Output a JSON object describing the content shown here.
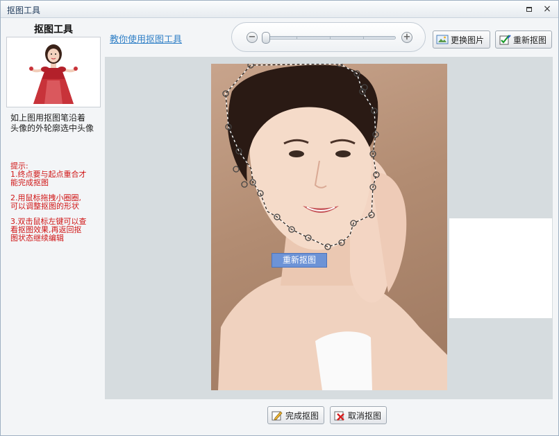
{
  "window": {
    "title": "抠图工具"
  },
  "left": {
    "title": "抠图工具",
    "instruction_line1": "如上图用抠图笔沿着",
    "instruction_line2": "头像的外轮廓选中头像",
    "tips_heading": "提示:",
    "tip1_line1": "1.终点要与起点重合才",
    "tip1_line2": "能完成抠图",
    "tip2_line1": "2.用鼠标拖拽小圈圈,",
    "tip2_line2": "可以调整抠图的形状",
    "tip3_line1": "3.双击鼠标左键可以查",
    "tip3_line2": "看抠图效果,再返回抠",
    "tip3_line3": "图状态继续编辑"
  },
  "toolbar": {
    "help_link": "教你使用抠图工具",
    "zoom_level": 0,
    "replace_label": "更换图片",
    "redo_label": "重新抠图"
  },
  "canvas": {
    "float_redo_label": "重新抠图"
  },
  "footer": {
    "finish_label": "完成抠图",
    "cancel_label": "取消抠图"
  },
  "colors": {
    "accent_link": "#2f7fc6",
    "tip_red": "#d01515",
    "float_button": "#6d93d6"
  }
}
